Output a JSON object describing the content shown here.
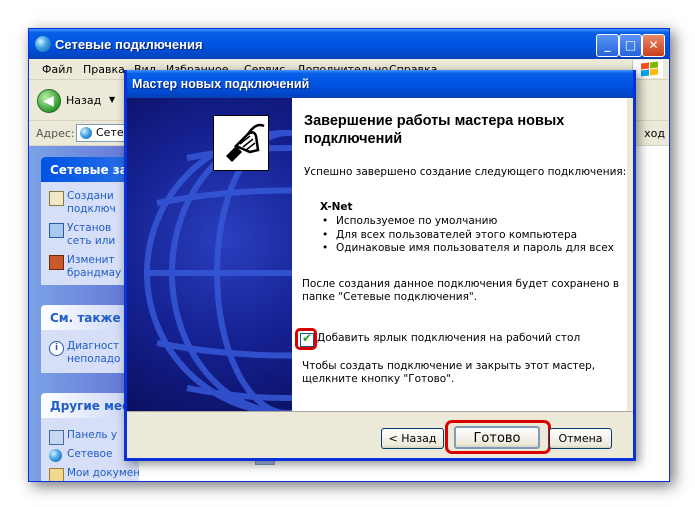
{
  "explorer": {
    "title": "Сетевые подключения",
    "menu": [
      "Файл",
      "Правка",
      "Вид",
      "Избранное",
      "Сервис",
      "Дополнительно",
      "Справка"
    ],
    "toolbar": {
      "back_label": "Назад"
    },
    "address": {
      "label": "Адрес:",
      "value": "Сете",
      "go_label": "ход"
    },
    "left_panel": {
      "tasks": {
        "title": "Сетевые за",
        "items": [
          {
            "line1": "Создани",
            "line2": "подключ"
          },
          {
            "line1": "Установ",
            "line2": "сеть или"
          },
          {
            "line1": "Изменит",
            "line2": "брандмау"
          }
        ]
      },
      "see_also": {
        "title": "См. также",
        "items": [
          {
            "line1": "Диагност",
            "line2": "неполадо"
          }
        ]
      },
      "other": {
        "title": "Другие мес",
        "items": [
          {
            "line1": "Панель у"
          },
          {
            "line1": "Сетевое"
          },
          {
            "line1": "Мои документы"
          }
        ]
      }
    },
    "window_buttons": {
      "minimize": "_",
      "maximize": "□",
      "close": "✕"
    }
  },
  "wizard": {
    "title": "Мастер новых подключений",
    "heading": "Завершение работы мастера новых подключений",
    "success_text": "Успешно завершено создание следующего подключения:",
    "connection_name": "X-Net",
    "properties": [
      "Используемое по умолчанию",
      "Для всех пользователей этого компьютера",
      "Одинаковые имя пользователя и пароль для всех"
    ],
    "after_text": "После создания данное подключения будет сохранено в папке \"Сетевые подключения\".",
    "checkbox": {
      "label": "Добавить ярлык подключения на рабочий стол",
      "checked": true,
      "mark": "✔"
    },
    "finish_hint": "Чтобы создать подключение и закрыть этот мастер, щелкните кнопку \"Готово\".",
    "buttons": {
      "back": "< Назад",
      "finish": "Готово",
      "cancel": "Отмена"
    }
  },
  "colors": {
    "titlebar_blue": "#0054e3",
    "highlight_red": "#d90000",
    "check_green": "#21a121",
    "banner_navy": "#14208f"
  }
}
